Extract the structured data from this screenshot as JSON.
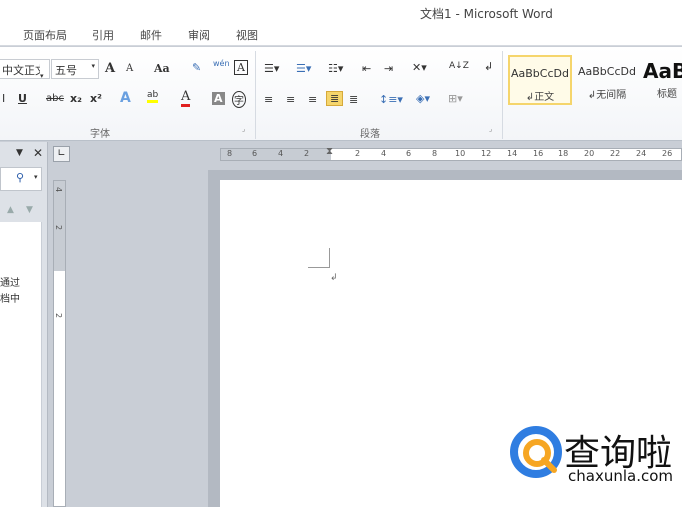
{
  "window": {
    "title": "文档1 - Microsoft Word"
  },
  "tabs": [
    {
      "label": "页面布局"
    },
    {
      "label": "引用"
    },
    {
      "label": "邮件"
    },
    {
      "label": "审阅"
    },
    {
      "label": "视图"
    }
  ],
  "font": {
    "name": "中文正文",
    "size": "五号",
    "grow": "A",
    "shrink": "A",
    "case": "Aa",
    "pinyin": "wén",
    "border": "A",
    "underline": "U",
    "strike": "abc",
    "sub": "x₂",
    "sup": "x²",
    "effects": "A",
    "highlight": "ab",
    "color": "A",
    "shading": "A",
    "enclose": "字",
    "group_label": "字体"
  },
  "paragraph": {
    "sort": "A↓Z",
    "group_label": "段落"
  },
  "styles": [
    {
      "sample": "AaBbCcDd",
      "name": "正文",
      "selected": true
    },
    {
      "sample": "AaBbCcDd",
      "name": "无间隔"
    },
    {
      "sample": "AaB",
      "name": "标题"
    }
  ],
  "nav": {
    "text1": "通过",
    "text2": "档中"
  },
  "ruler": {
    "left_ticks": [
      "8",
      "6",
      "4",
      "2"
    ],
    "right_ticks": [
      "2",
      "4",
      "6",
      "8",
      "10",
      "12",
      "14",
      "16",
      "18",
      "20",
      "22",
      "24",
      "26"
    ],
    "vertical_ticks": [
      "4",
      "2",
      "2"
    ]
  },
  "watermark": {
    "name": "查询啦",
    "url": "chaxunla.com"
  },
  "colors": {
    "accent_selected": "#f5d56c",
    "highlight": "#ffff00",
    "font_color": "#e02020",
    "logo_blue": "#2f7de1",
    "logo_orange": "#f6a623"
  }
}
